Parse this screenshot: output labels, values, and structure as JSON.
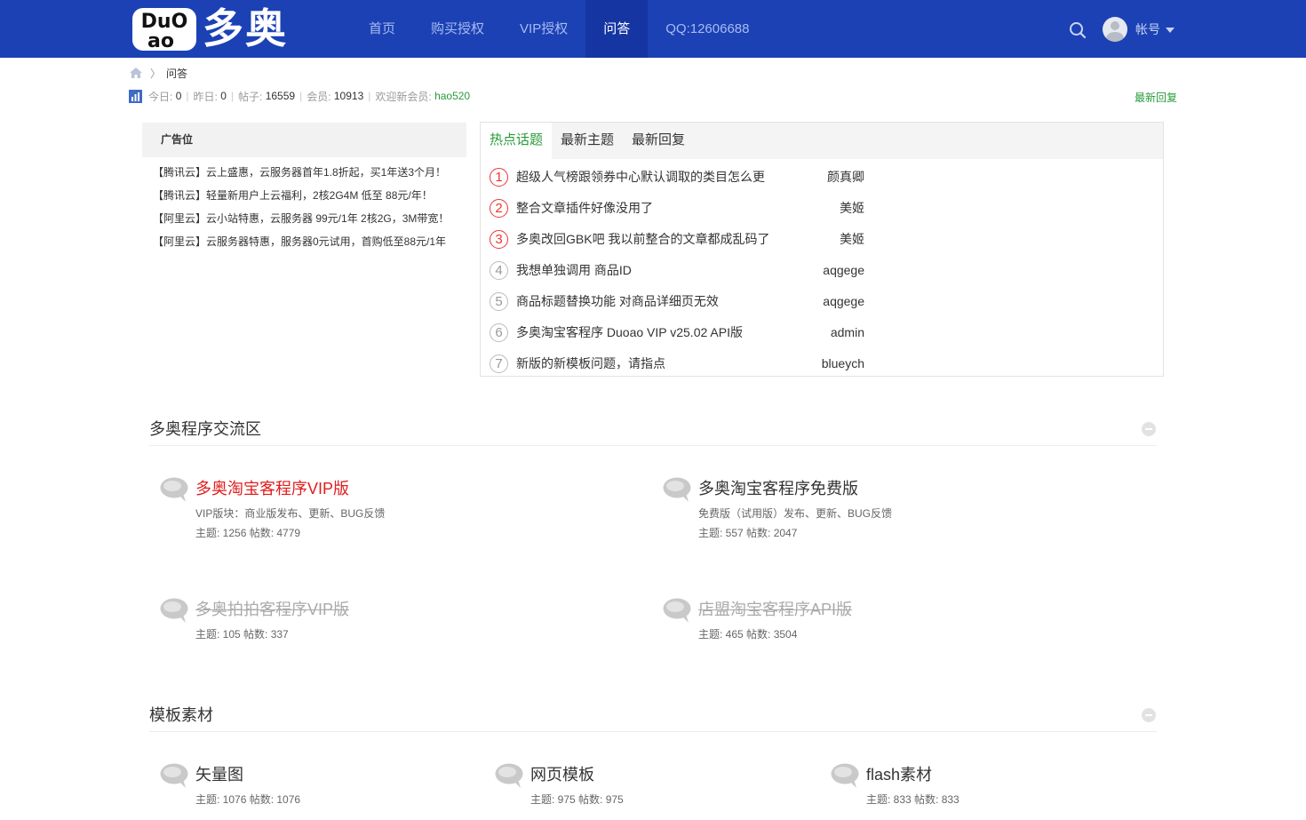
{
  "header": {
    "logo_text": "多奥",
    "logo_badge_top": "DuO",
    "logo_badge_bottom": "ao",
    "nav": [
      "首页",
      "购买授权",
      "VIP授权",
      "问答",
      "QQ:12606688"
    ],
    "active_nav_index": 3,
    "user_label": "帐号"
  },
  "breadcrumb": {
    "current": "问答",
    "separator": "〉"
  },
  "stats": {
    "today_label": "今日:",
    "today": "0",
    "yesterday_label": "昨日:",
    "yesterday": "0",
    "posts_label": "帖子:",
    "posts": "16559",
    "members_label": "会员:",
    "members": "10913",
    "welcome_label": "欢迎新会员:",
    "new_member": "hao520",
    "latest_reply_link": "最新回复"
  },
  "ad": {
    "title": "广告位",
    "items": [
      "【腾讯云】云上盛惠，云服务器首年1.8折起，买1年送3个月！",
      "【腾讯云】轻量新用户上云福利，2核2G4M 低至 88元/年！",
      "【阿里云】云小站特惠，云服务器 99元/1年 2核2G，3M带宽！",
      "【阿里云】云服务器特惠，服务器0元试用，首购低至88元/1年"
    ]
  },
  "hot": {
    "tabs": [
      "热点话题",
      "最新主题",
      "最新回复"
    ],
    "active_tab": 0,
    "rows": [
      {
        "num": "1",
        "title": "超级人气榜跟领券中心默认调取的类目怎么更",
        "author": "颜真卿"
      },
      {
        "num": "2",
        "title": "整合文章插件好像没用了",
        "author": "美姬"
      },
      {
        "num": "3",
        "title": "多奥改回GBK吧 我以前整合的文章都成乱码了",
        "author": "美姬"
      },
      {
        "num": "4",
        "title": "我想单独调用 商品ID",
        "author": "aqgege"
      },
      {
        "num": "5",
        "title": "商品标题替换功能 对商品详细页无效",
        "author": "aqgege"
      },
      {
        "num": "6",
        "title": "多奥淘宝客程序 Duoao VIP v25.02 API版",
        "author": "admin"
      },
      {
        "num": "7",
        "title": "新版的新模板问题，请指点",
        "author": "bluеych"
      }
    ]
  },
  "sections": [
    {
      "title": "多奥程序交流区",
      "forums": [
        {
          "name": "多奥淘宝客程序VIP版",
          "desc": "VIP版块：商业版发布、更新、BUG反馈",
          "stat": "主题: 1256 帖数: 4779"
        },
        {
          "name": "多奥淘宝客程序免费版",
          "desc": "免费版（试用版）发布、更新、BUG反馈",
          "stat": "主题: 557 帖数: 2047"
        },
        {
          "name": "多奥拍拍客程序VIP版",
          "desc": "",
          "stat": "主题: 105 帖数: 337"
        },
        {
          "name": "店盟淘宝客程序API版",
          "desc": "",
          "stat": "主题: 465 帖数: 3504"
        }
      ]
    },
    {
      "title": "模板素材",
      "forums": [
        {
          "name": "矢量图",
          "desc": "",
          "stat": "主题: 1076 帖数: 1076"
        },
        {
          "name": "网页模板",
          "desc": "",
          "stat": "主题: 975 帖数: 975"
        },
        {
          "name": "flash素材",
          "desc": "",
          "stat": "主题: 833 帖数: 833"
        }
      ]
    }
  ],
  "colors": {
    "header_bg": "#1b41b5",
    "header_active": "#1535a2",
    "accent_green": "#2a9b3a",
    "rank_red": "#e33333",
    "forum_red": "#e11d1d"
  }
}
